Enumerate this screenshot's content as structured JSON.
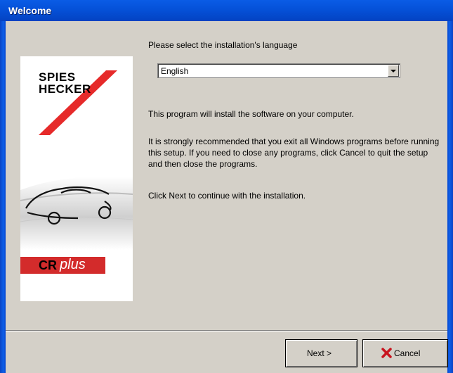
{
  "window": {
    "title": "Welcome"
  },
  "banner": {
    "brand_line1": "SPIES",
    "brand_line2": "HECKER",
    "product_bold": "CR",
    "product_italic": "plus",
    "accent_color": "#d32b2b"
  },
  "language": {
    "label": "Please select the installation's language",
    "selected": "English"
  },
  "body": {
    "p1": "This program will install the software on your computer.",
    "p2": "It is strongly recommended that you exit all Windows programs before running this setup. If you need to close any programs, click Cancel to quit the setup and then close the programs.",
    "p3": "Click Next to continue with the installation."
  },
  "buttons": {
    "next_label": "Next >",
    "cancel_label": "Cancel",
    "cancel_icon": "x-icon"
  }
}
